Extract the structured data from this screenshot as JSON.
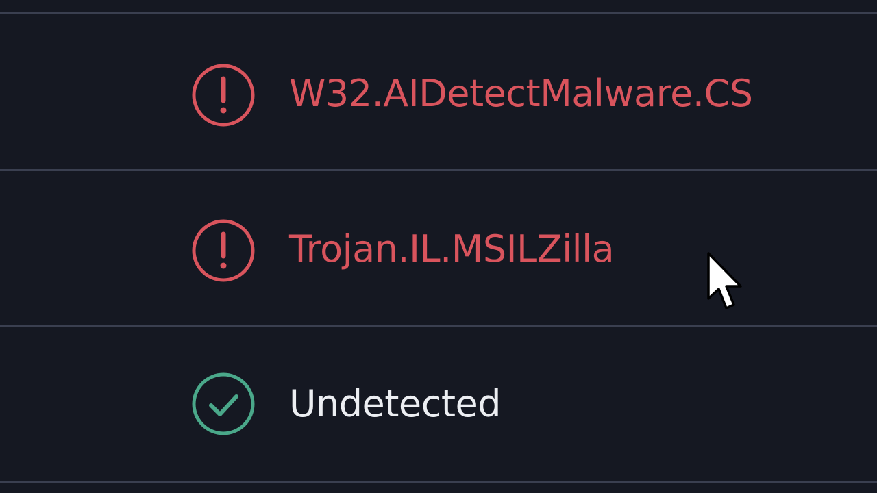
{
  "detections": [
    {
      "label": "W32.AIDetectMalware.CS",
      "status": "malicious",
      "icon": "alert-circle-icon",
      "color": "#d9545d"
    },
    {
      "label": "Trojan.IL.MSILZilla",
      "status": "malicious",
      "icon": "alert-circle-icon",
      "color": "#d9545d"
    },
    {
      "label": "Undetected",
      "status": "clean",
      "icon": "check-circle-icon",
      "color": "#4aa88a"
    }
  ],
  "cursor": {
    "icon": "mouse-pointer-icon"
  },
  "theme": {
    "background": "#151822",
    "divider": "#3a3f50",
    "malicious": "#d9545d",
    "clean_icon": "#4aa88a",
    "clean_text": "#eceef2"
  }
}
